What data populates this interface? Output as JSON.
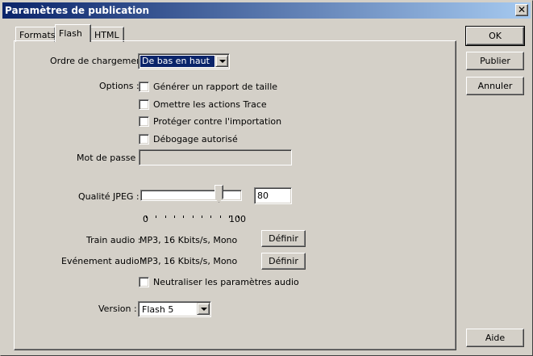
{
  "window": {
    "title": "Paramètres de publication",
    "close_glyph": "✕"
  },
  "tabs": [
    {
      "label": "Formats",
      "active": false
    },
    {
      "label": "Flash",
      "active": true
    },
    {
      "label": "HTML",
      "active": false
    }
  ],
  "flash": {
    "load_order": {
      "label": "Ordre de chargement :",
      "value": "De bas en haut"
    },
    "options_label": "Options :",
    "options": [
      {
        "label": "Générer un rapport de taille",
        "checked": false
      },
      {
        "label": "Omettre les actions Trace",
        "checked": false
      },
      {
        "label": "Protéger contre l'importation",
        "checked": false
      },
      {
        "label": "Débogage autorisé",
        "checked": false
      }
    ],
    "password": {
      "label": "Mot de passe :",
      "value": ""
    },
    "jpeg": {
      "label": "Qualité JPEG :",
      "value": "80",
      "min_label": "0",
      "max_label": "100",
      "level": 80
    },
    "audio_stream": {
      "label": "Train audio :",
      "value": "MP3, 16 Kbits/s, Mono",
      "button": "Définir"
    },
    "audio_event": {
      "label": "Evénement audio :",
      "value": "MP3, 16 Kbits/s, Mono",
      "button": "Définir"
    },
    "override_audio": {
      "label": "Neutraliser les paramètres audio",
      "checked": false
    },
    "version": {
      "label": "Version :",
      "value": "Flash 5"
    }
  },
  "buttons": {
    "ok": "OK",
    "publish": "Publier",
    "cancel": "Annuler",
    "help": "Aide"
  },
  "colors": {
    "face": "#d4d0c8",
    "title_start": "#0a246a",
    "title_end": "#a6caf0",
    "selection": "#0a246a"
  }
}
